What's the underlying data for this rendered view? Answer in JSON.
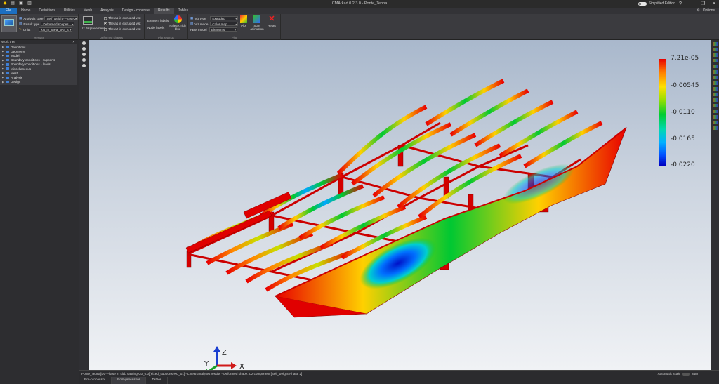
{
  "app": {
    "title": "CMArkad 0.2.3.0 - Ponte_Teona",
    "edition": "Simplified Edition",
    "options_label": "Options",
    "window_controls": [
      "—",
      "❐",
      "✕"
    ],
    "help_icon": "?"
  },
  "menu": {
    "tabs": [
      "File",
      "Home",
      "Definitions",
      "Utilities",
      "Mesh",
      "Analysis",
      "Design - concrete",
      "Results",
      "Tables"
    ],
    "active": "Results"
  },
  "ribbon": {
    "results_group": {
      "title": "Results",
      "analysis_case_label": "Analysis case",
      "analysis_case_value": "Self_weight-Phase 2",
      "result_type_label": "Result type",
      "result_type_value": "Deformed shapes",
      "units_label": "Units",
      "units_value": "kN_m_MPa_kPa_s"
    },
    "deformed_group": {
      "title": "Deformed shapes",
      "component_value": "Uz displacement",
      "check1": "Theta1 in extruded vist",
      "check2": "Theta1 in extruded vist",
      "check3": "Theta2 in extruded vist"
    },
    "plot_settings_group": {
      "title": "Plot settings",
      "element_labels": "Element labels",
      "node_labels": "Node labels",
      "palette_label": "Palette: rich",
      "palette_sub": "blue"
    },
    "plot_group": {
      "title": "Plot",
      "viz_type_label": "Viz type",
      "viz_type_value": "Extruded",
      "viz_mode_label": "Viz mode",
      "viz_mode_value": "Color map",
      "fem_model_label": "FEM model",
      "fem_model_value": "Elements",
      "plot_btn": "Plot",
      "animation_btn": "Start animation",
      "reset_btn": "Reset"
    }
  },
  "worktree": {
    "title": "Work tree",
    "items": [
      "Definitions",
      "Geometry",
      "Model",
      "Boundary conditions - supports",
      "Boundary conditions - loads",
      "Miscellaneous",
      "Mesh",
      "Analysis",
      "Design"
    ]
  },
  "colorbar": {
    "labels": [
      "7.21e-05",
      "-0.00545",
      "-0.0110",
      "-0.0165",
      "-0.0220"
    ],
    "colors": [
      "#e80000",
      "#ff7a00",
      "#ffe000",
      "#00cc30",
      "#00b0ff",
      "#0000c0"
    ]
  },
  "axes": {
    "x": "X",
    "y": "Y",
    "z": "Z"
  },
  "status": {
    "text": "Ponte_Teona[D1-Phase 2- slab casting-C0_0.0][Fixed_supports-RC_01] - Linear analyses results - Deformed shape: Uz component [Self_weight-Phase 2]",
    "autoscale_label": "Automatic scale",
    "autoscale_value": "auto"
  },
  "bottom_tabs": [
    "Pre-processor",
    "Post-processor",
    "Tables"
  ],
  "bottom_active": "Post-processor"
}
